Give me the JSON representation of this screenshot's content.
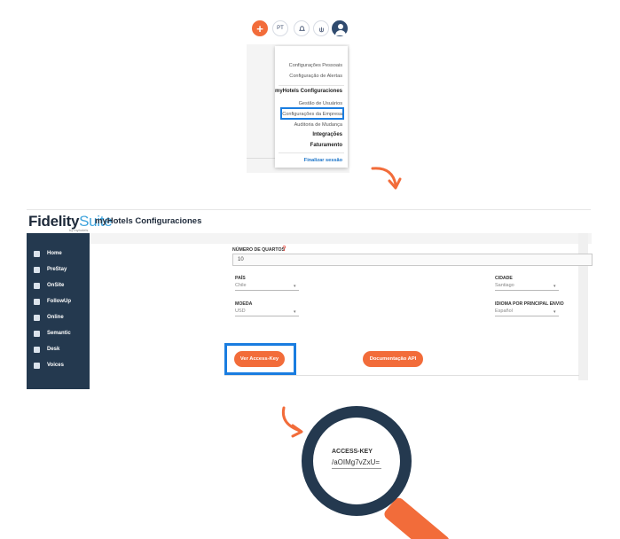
{
  "top_bar": {
    "add_label": "+",
    "language_label": "PT"
  },
  "user_menu": {
    "items": [
      "Configurações Pessoais",
      "Configuração de Alertas",
      "myHotels Configuraciones",
      "Gestão de Usuários",
      "Configurações da Empresa",
      "Auditoria de Mudança",
      "Integrações",
      "Faturamento",
      "Finalizar sessão"
    ]
  },
  "app": {
    "brand_main": "Fidelity",
    "brand_suite": "Suite",
    "brand_sub": "by myhotels",
    "title": "myHotels Configuraciones"
  },
  "sidebar": {
    "items": [
      {
        "label": "Home",
        "icon": "home-icon"
      },
      {
        "label": "PreStay",
        "icon": "bag-icon"
      },
      {
        "label": "OnSite",
        "icon": "bed-icon"
      },
      {
        "label": "FollowUp",
        "icon": "followup-icon"
      },
      {
        "label": "Online",
        "icon": "laptop-icon"
      },
      {
        "label": "Semantic",
        "icon": "chat-icon"
      },
      {
        "label": "Desk",
        "icon": "desk-icon"
      },
      {
        "label": "Voices",
        "icon": "microphone-icon"
      }
    ]
  },
  "form": {
    "rooms_label": "NÚMERO DE QUARTOS",
    "rooms_value": "10",
    "country_label": "PAÍS",
    "country_value": "Chile",
    "city_label": "CIDADE",
    "city_value": "Santiago",
    "currency_label": "MOEDA",
    "currency_value": "USD",
    "language_label": "IDIOMA POR PRINCIPAL ENVIO",
    "language_value": "Español",
    "access_key_button": "Ver Access-Key",
    "api_docs_button": "Documentação API"
  },
  "magnifier": {
    "label": "ACCESS-KEY",
    "value": "/aOIMg7vZxU="
  },
  "colors": {
    "accent_orange": "#f26c3a",
    "highlight_blue": "#1a7de0",
    "sidebar_navy": "#24394f"
  }
}
